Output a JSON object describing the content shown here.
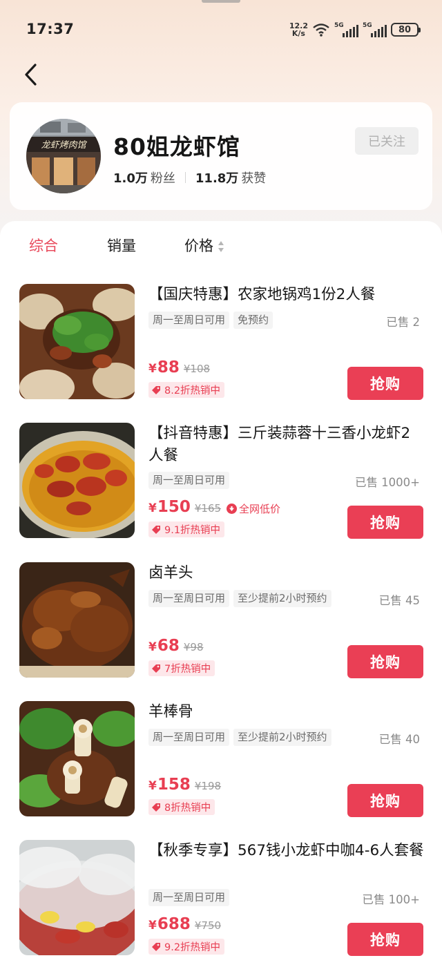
{
  "status_bar": {
    "time": "17:37",
    "net_speed_value": "12.2",
    "net_speed_unit": "K/s",
    "signal_1": "5G",
    "signal_2": "5G",
    "battery": "80"
  },
  "shop": {
    "name": "80姐龙虾馆",
    "avatar_sign_text": "龙虾烤肉馆",
    "fans_count": "1.0万",
    "fans_label": "粉丝",
    "likes_count": "11.8万",
    "likes_label": "获赞",
    "follow_label": "已关注"
  },
  "sort_tabs": {
    "comprehensive": "综合",
    "sales": "销量",
    "price": "价格",
    "active": "综合"
  },
  "colors": {
    "accent": "#e83e52",
    "buy_button": "#ea3f55",
    "tag_bg": "#f4f4f4"
  },
  "products": [
    {
      "title": "【国庆特惠】农家地锅鸡1份2人餐",
      "tags": [
        "周一至周日可用",
        "免预约"
      ],
      "sold": "已售 2",
      "currency": "¥",
      "price": "88",
      "original_price": "¥108",
      "discount": "8.2折热销中",
      "buy_label": "抢购"
    },
    {
      "title": "【抖音特惠】三斤装蒜蓉十三香小龙虾2人餐",
      "tags": [
        "周一至周日可用"
      ],
      "sold": "已售 1000+",
      "currency": "¥",
      "price": "150",
      "original_price": "¥165",
      "lowest_label": "全网低价",
      "discount": "9.1折热销中",
      "buy_label": "抢购"
    },
    {
      "title": "卤羊头",
      "tags": [
        "周一至周日可用",
        "至少提前2小时预约"
      ],
      "sold": "已售 45",
      "currency": "¥",
      "price": "68",
      "original_price": "¥98",
      "discount": "7折热销中",
      "buy_label": "抢购"
    },
    {
      "title": "羊棒骨",
      "tags": [
        "周一至周日可用",
        "至少提前2小时预约"
      ],
      "sold": "已售 40",
      "currency": "¥",
      "price": "158",
      "original_price": "¥198",
      "discount": "8折热销中",
      "buy_label": "抢购"
    },
    {
      "title": "【秋季专享】567钱小龙虾中咖4-6人套餐",
      "tags": [
        "周一至周日可用"
      ],
      "sold": "已售 100+",
      "currency": "¥",
      "price": "688",
      "original_price": "¥750",
      "discount": "9.2折热销中",
      "buy_label": "抢购"
    }
  ]
}
